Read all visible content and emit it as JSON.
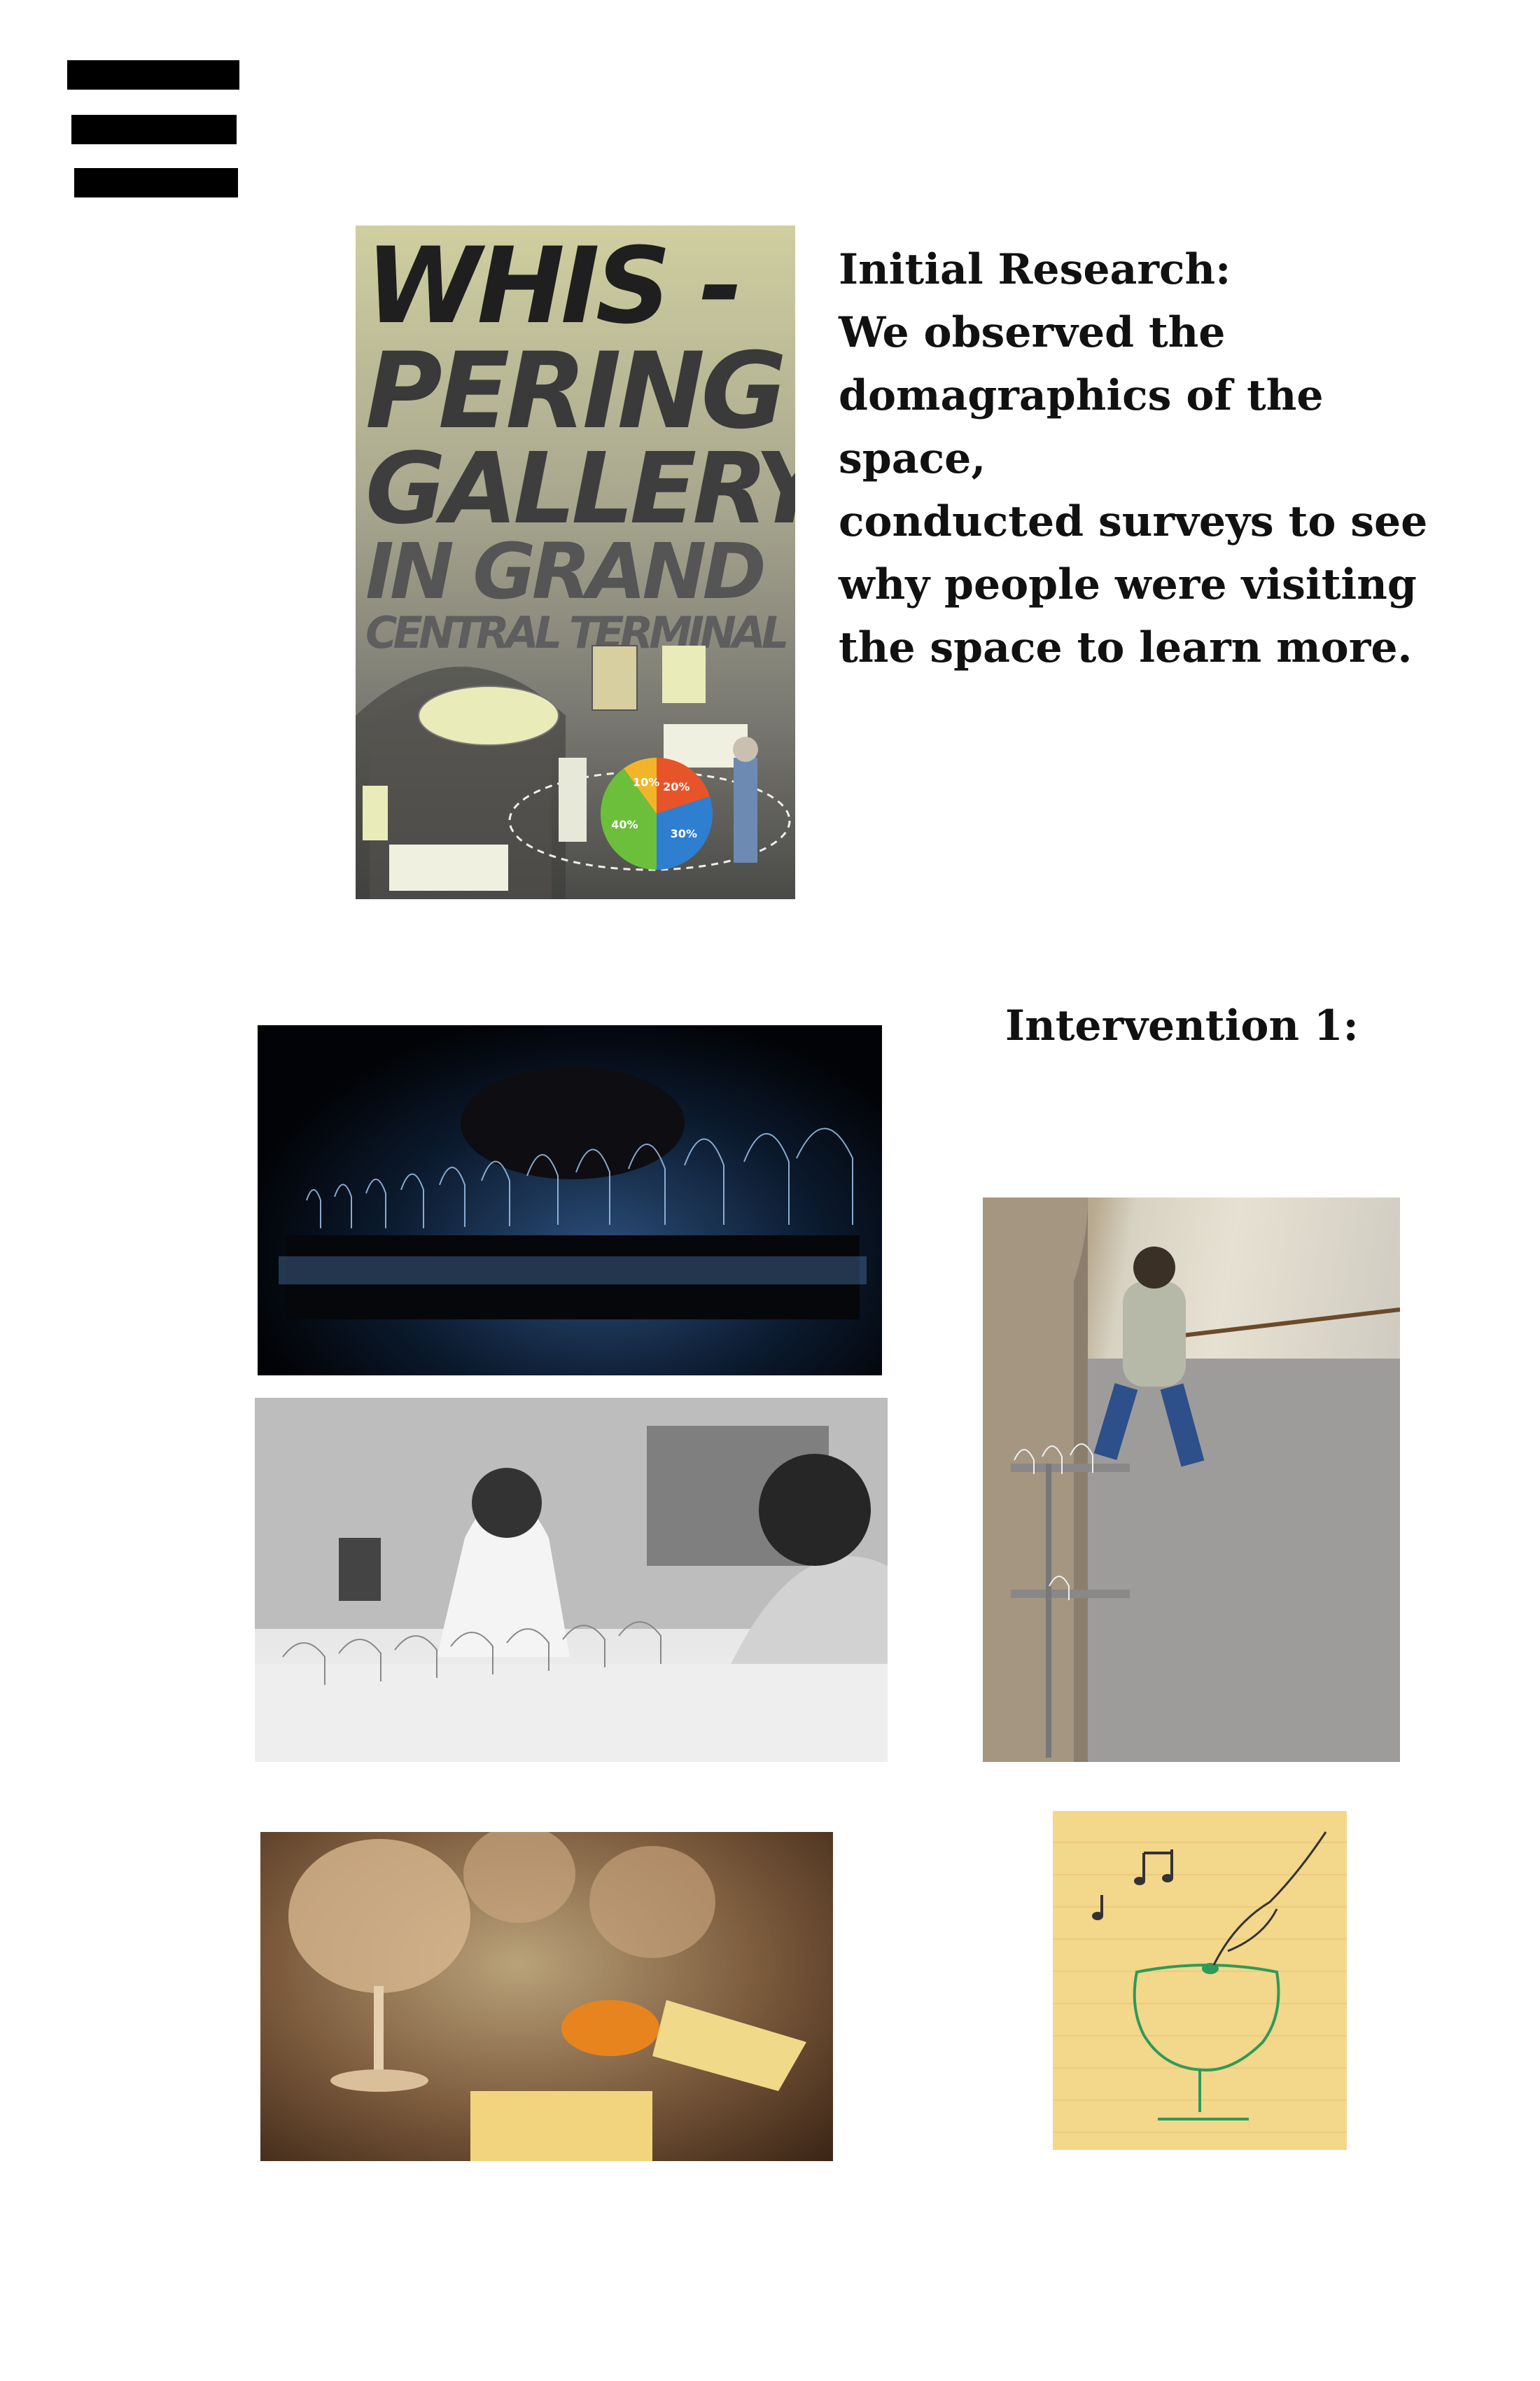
{
  "menu": {
    "icon": "hamburger-menu-icon"
  },
  "research": {
    "lines": [
      "Initial Research:",
      "We observed the",
      "domagraphics of the space,",
      "conducted surveys to see",
      "why people were visiting",
      "the space to learn more."
    ]
  },
  "poster": {
    "lines": [
      "WHIS -",
      "PERING",
      "GALLERY",
      "IN GRAND",
      "CENTRAL TERMINAL"
    ],
    "chart": {
      "type": "pie",
      "slices": [
        {
          "label": "20%",
          "value": 20,
          "color": "#e8542a"
        },
        {
          "label": "30%",
          "value": 30,
          "color": "#2f7fd1"
        },
        {
          "label": "40%",
          "value": 40,
          "color": "#6cbf3a"
        },
        {
          "label": "10%",
          "value": 10,
          "color": "#f2b52a"
        }
      ]
    }
  },
  "intervention": {
    "title": "Intervention 1:"
  }
}
